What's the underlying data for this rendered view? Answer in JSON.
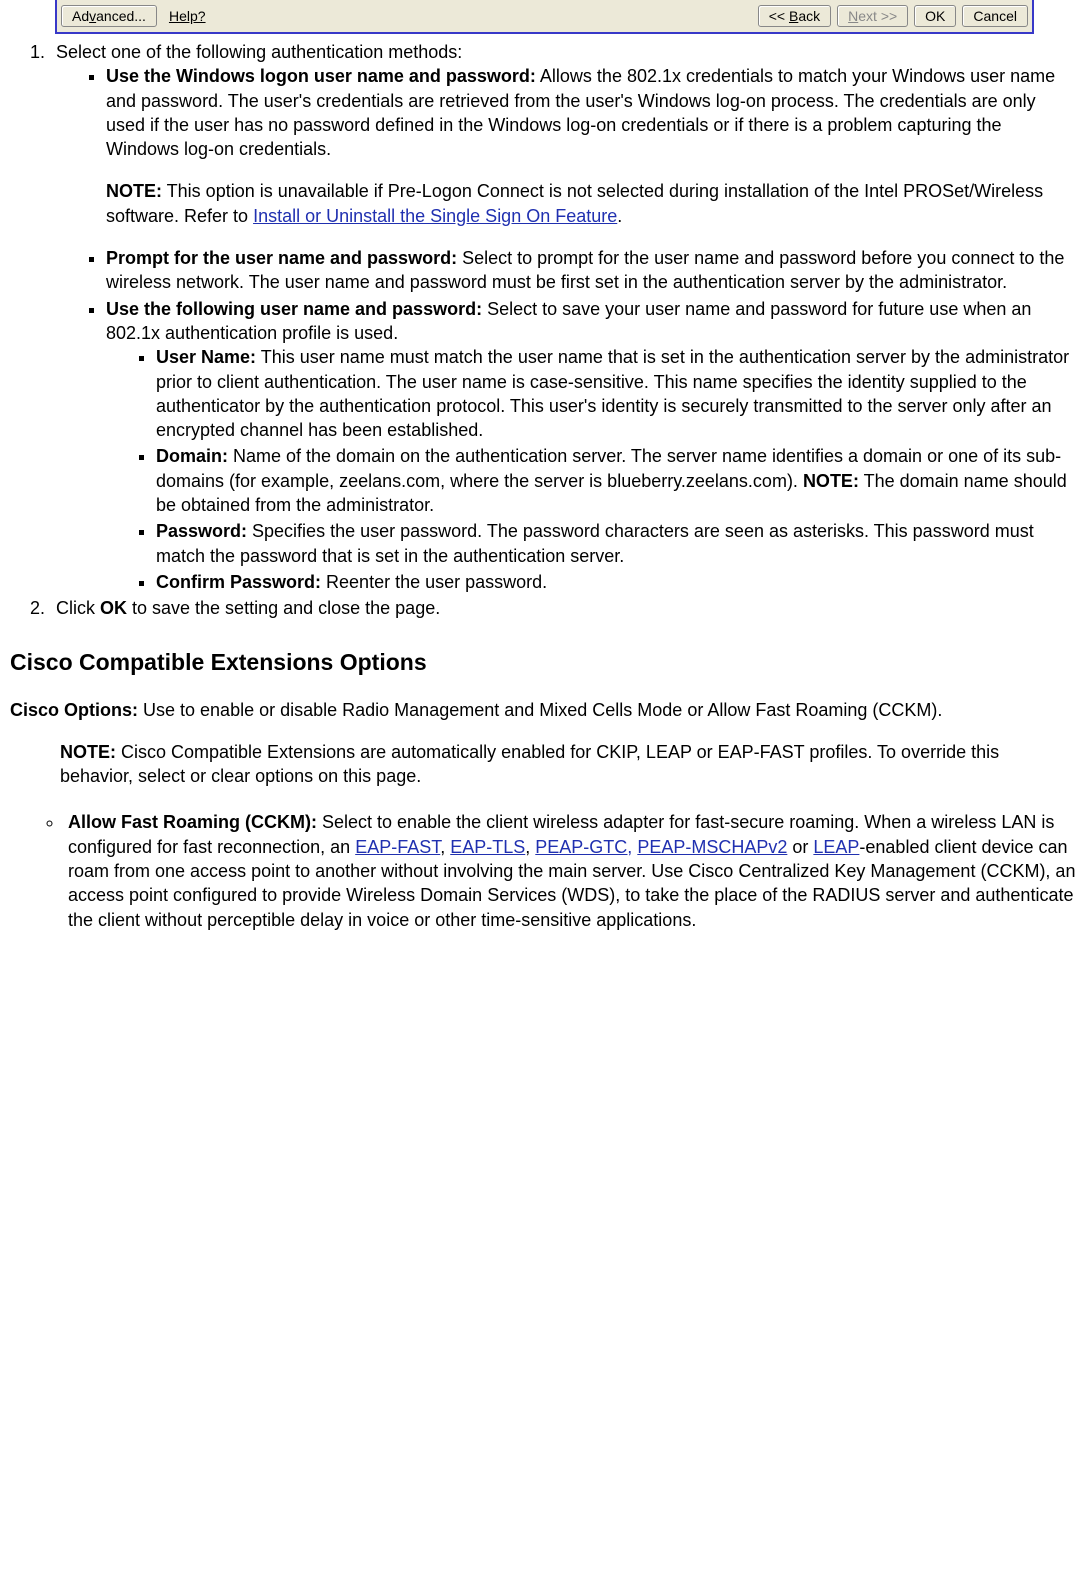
{
  "toolbar": {
    "advanced": "Advanced...",
    "help": "Help?",
    "back": "<< Back",
    "next": "Next >>",
    "ok": "OK",
    "cancel": "Cancel"
  },
  "step1": {
    "intro": "Select one of the following authentication methods:",
    "opt1": {
      "title": "Use the Windows logon user name and password:",
      "text": " Allows the 802.1x credentials to match your Windows user name and password. The user's credentials are retrieved from the user's Windows log-on process. The credentials are only used if the user has no password defined in the Windows log-on credentials or if there is a problem capturing the Windows log-on credentials.",
      "note_label": "NOTE:",
      "note_pre": " This option is unavailable if Pre-Logon Connect is not selected during installation of the Intel PROSet/Wireless software. Refer to ",
      "note_link": "Install or Uninstall the Single Sign On Feature",
      "note_post": "."
    },
    "opt2": {
      "title": "Prompt for the user name and password:",
      "text": " Select to prompt for the user name and password before you connect to the wireless network. The user name and password must be first set in the authentication server by the administrator."
    },
    "opt3": {
      "title": "Use the following user name and password:",
      "text": " Select to save your user name and password for future use when an 802.1x authentication profile is used.",
      "sub": {
        "username_t": "User Name:",
        "username": " This user name must match the user name that is set in the authentication server by the administrator prior to client authentication. The user name is case-sensitive. This name specifies the identity supplied to the authenticator by the authentication protocol. This user's identity is securely transmitted to the server only after an encrypted channel has been established.",
        "domain_t": "Domain:",
        "domain_a": " Name of the domain on the authentication server. The server name identifies a domain or one of its sub-domains (for example, zeelans.com, where the server is blueberry.zeelans.com). ",
        "domain_note_t": "NOTE:",
        "domain_b": " The domain name should be obtained from the administrator.",
        "password_t": "Password:",
        "password": " Specifies the user password. The password characters are seen as asterisks. This password must match the password that is set in the authentication server.",
        "confirm_t": "Confirm Password:",
        "confirm": " Reenter the user password."
      }
    }
  },
  "step2": {
    "pre": "Click ",
    "ok": "OK",
    "post": " to save the setting and close the page."
  },
  "cisco": {
    "heading": "Cisco Compatible Extensions Options",
    "opt_t": "Cisco Options:",
    "opt_text": " Use to enable or disable Radio Management and Mixed Cells Mode or Allow Fast Roaming (CCKM).",
    "note_t": "NOTE:",
    "note": " Cisco Compatible Extensions are automatically enabled for CKIP, LEAP or EAP-FAST profiles. To override this behavior, select or clear options on this page.",
    "cckm_t": "Allow Fast Roaming (CCKM):",
    "cckm_pre": " Select to enable the client wireless adapter for fast-secure roaming. When a wireless LAN is configured for fast reconnection, an ",
    "l1": "EAP-FAST",
    "c1": ", ",
    "l2": "EAP-TLS",
    "c2": ", ",
    "l3": "PEAP-GTC,",
    "c3": " ",
    "l4": "PEAP-MSCHAPv2",
    "c4": " or ",
    "l5": "LEAP",
    "cckm_post": "-enabled client device can roam from one access point to another without involving the main server. Use Cisco Centralized Key Management (CCKM), an access point configured to provide Wireless Domain Services (WDS), to take the place of the RADIUS server and authenticate the client without perceptible delay in voice or other time-sensitive applications."
  }
}
